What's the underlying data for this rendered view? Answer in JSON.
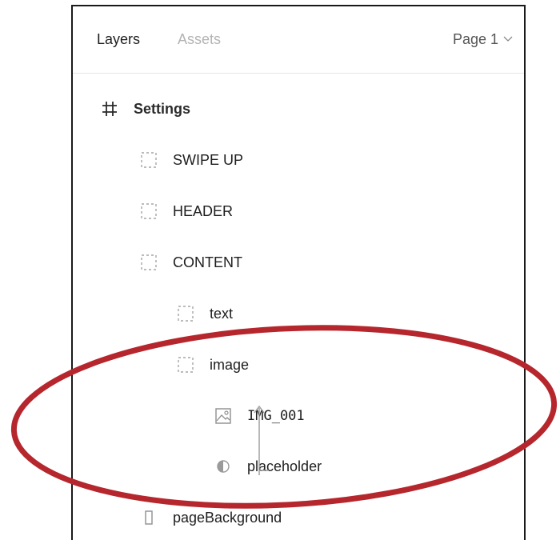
{
  "panel": {
    "tabs": [
      {
        "label": "Layers",
        "active": true
      },
      {
        "label": "Assets",
        "active": false
      }
    ],
    "page_select": {
      "label": "Page 1"
    }
  },
  "layers": {
    "frame": {
      "label": "Settings",
      "icon": "hash-frame-icon"
    },
    "items": [
      {
        "label": "SWIPE UP",
        "icon": "dashed-frame-icon"
      },
      {
        "label": "HEADER",
        "icon": "dashed-frame-icon"
      },
      {
        "label": "CONTENT",
        "icon": "dashed-frame-icon"
      },
      {
        "label": "text",
        "icon": "dashed-frame-icon"
      },
      {
        "label": "image",
        "icon": "dashed-frame-icon"
      },
      {
        "label": "IMG_001",
        "icon": "image-icon"
      },
      {
        "label": "placeholder",
        "icon": "half-circle-icon"
      },
      {
        "label": "pageBackground",
        "icon": "rectangle-icon"
      }
    ]
  },
  "annotation": {
    "color": "#b5272d"
  },
  "colors": {
    "text": "#1e1e1e",
    "muted": "#b3b3b3",
    "icon": "#a6a6a6",
    "border": "#1a1a1a"
  }
}
